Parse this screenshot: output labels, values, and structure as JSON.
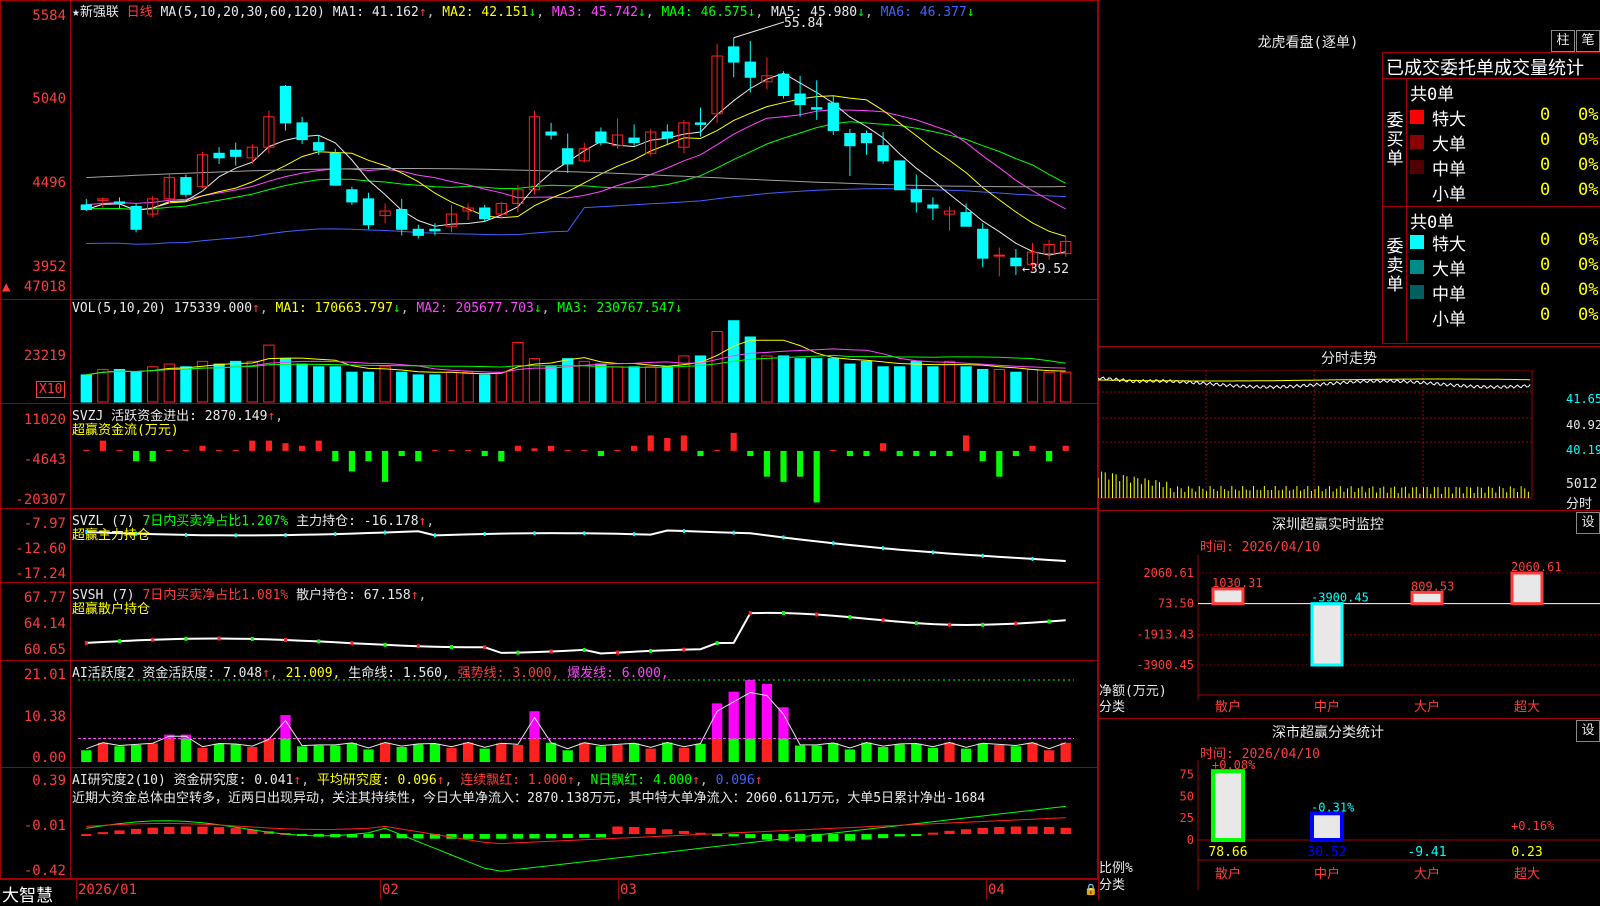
{
  "app": {
    "logo": "大智慧",
    "title_star": "★",
    "stock_name": "新强联",
    "period": "日线"
  },
  "colors": {
    "up": "#ff2020",
    "down": "#00ffff",
    "ma1": "#e8e8e8",
    "ma2": "#ffff00",
    "ma3": "#ff44ff",
    "ma4": "#00ff00",
    "ma5": "#e8e8e8",
    "ma6": "#4060ff"
  },
  "kline": {
    "header": {
      "ma_label": "MA(5,10,20,30,60,120)",
      "ma1": "MA1: 41.162",
      "ma2": "MA2: 42.151",
      "ma3": "MA3: 45.742",
      "ma4": "MA4: 46.575",
      "ma5": "MA5: 45.980",
      "ma6": "MA6: 46.377"
    },
    "y_labels": [
      "5584",
      "5040",
      "4496",
      "3952"
    ],
    "high_note": "55.84",
    "low_note": "←39.52"
  },
  "vol": {
    "header": {
      "label": "VOL(5,10,20)",
      "value": "175339.000",
      "ma1": "MA1: 170663.797",
      "ma2": "MA2: 205677.703",
      "ma3": "MA3: 230767.547"
    },
    "y_labels": [
      "47018",
      "23219"
    ],
    "unit": "X10"
  },
  "svzj": {
    "header": {
      "label": "SVZJ",
      "text": "活跃资金进出: 2870.149",
      "sub": "超赢资金流(万元)"
    },
    "y_labels": [
      "11020",
      "-4643",
      "-20307"
    ]
  },
  "svzl": {
    "header": {
      "label": "SVZL (7)",
      "text1": "7日内买卖净占比1.207%",
      "text2": "主力持仓: -16.178",
      "sub": "超赢主力持仓"
    },
    "y_labels": [
      "-7.97",
      "-12.60",
      "-17.24"
    ]
  },
  "svsh": {
    "header": {
      "label": "SVSH (7)",
      "text1": "7日内买卖净占比1.081%",
      "text2": "散户持仓: 67.158",
      "sub": "超赢散户持仓"
    },
    "y_labels": [
      "67.77",
      "64.14",
      "60.65"
    ]
  },
  "ai2": {
    "header": {
      "label": "AI活跃度2",
      "t1": "资金活跃度: 7.048",
      "t2": "21.009,",
      "t3": "生命线: 1.560,",
      "t4": "强势线: 3.000,",
      "t5": "爆发线: 6.000,"
    },
    "y_labels": [
      "21.01",
      "10.38",
      "0.00"
    ]
  },
  "ai_research": {
    "header": {
      "label": "AI研究度2(10)",
      "t1": "资金研究度: 0.041",
      "t2": "平均研究度: 0.096",
      "t3": "连续飘红: 1.000",
      "t4": "N日飘红: 4.000",
      "t5": "0.096"
    },
    "summary": "近期大资金总体由空转多，近两日出现异动，关注其持续性，今日大单净流入：2870.138万元，其中特大单净流入：2060.611万元，大单5日累计净出-1684",
    "y_labels": [
      "0.39",
      "-0.01",
      "-0.42"
    ]
  },
  "x_axis": [
    "2026/01",
    "02",
    "03",
    "04"
  ],
  "right": {
    "dragon": {
      "title": "龙虎看盘(逐单)",
      "btn1": "柱",
      "btn2": "笔",
      "subtitle": "已成交委托单成交量统计",
      "buy_label": "委买单",
      "sell_label": "委卖单",
      "buy_total": "共0单",
      "sell_total": "共0单",
      "buy_rows": [
        {
          "name": "特大",
          "v": "0",
          "p": "0%"
        },
        {
          "name": "大单",
          "v": "0",
          "p": "0%"
        },
        {
          "name": "中单",
          "v": "0",
          "p": "0%"
        },
        {
          "name": "小单",
          "v": "0",
          "p": "0%"
        }
      ],
      "sell_rows": [
        {
          "name": "特大",
          "v": "0",
          "p": "0%"
        },
        {
          "name": "大单",
          "v": "0",
          "p": "0%"
        },
        {
          "name": "中单",
          "v": "0",
          "p": "0%"
        },
        {
          "name": "小单",
          "v": "0",
          "p": "0%"
        }
      ]
    },
    "intraday": {
      "title": "分时走势",
      "p1": "41.65",
      "p2": "40.92",
      "p3": "40.19",
      "vol": "5012",
      "unit": "分时"
    },
    "monitor": {
      "title": "深圳超赢实时监控",
      "btn": "设",
      "time": "时间: 2026/04/10",
      "y_labels": [
        "2060.61",
        "73.50",
        "-1913.43",
        "-3900.45"
      ],
      "axis_name": "净额(万元)",
      "axis_cat": "分类",
      "categories": [
        "散户",
        "中户",
        "大户",
        "超大"
      ],
      "values": [
        1030.31,
        -3900.45,
        809.53,
        2060.61
      ],
      "value_labels": [
        "1030.31",
        "-3900.45",
        "809.53",
        "2060.61"
      ]
    },
    "classify": {
      "title": "深市超赢分类统计",
      "btn": "设",
      "time": "时间: 2026/04/10",
      "y_labels": [
        "75",
        "50",
        "25",
        "0"
      ],
      "axis_name": "比例%",
      "axis_cat": "分类",
      "categories": [
        "散户",
        "中户",
        "大户",
        "超大"
      ],
      "values": [
        78.66,
        30.52,
        -9.41,
        0.23
      ],
      "value_labels": [
        "78.66",
        "30.52",
        "-9.41",
        "0.23"
      ],
      "change_labels": [
        "+0.08%",
        "-0.31%",
        "",
        "+0.16%"
      ]
    }
  },
  "chart_data": [
    {
      "type": "candlestick",
      "title": "新强联 日线",
      "ylim": [
        39.52,
        55.84
      ],
      "ohlc": [
        [
          44.2,
          44.6,
          43.8,
          43.9
        ],
        [
          44.5,
          44.7,
          44.0,
          44.6
        ],
        [
          44.4,
          44.7,
          44.0,
          44.3
        ],
        [
          44.1,
          44.3,
          42.4,
          42.6
        ],
        [
          43.6,
          44.8,
          43.4,
          44.6
        ],
        [
          44.6,
          46.2,
          44.3,
          46.0
        ],
        [
          46.0,
          46.2,
          44.7,
          44.9
        ],
        [
          45.4,
          47.7,
          45.3,
          47.5
        ],
        [
          47.6,
          48.0,
          46.9,
          47.3
        ],
        [
          47.8,
          48.3,
          46.8,
          47.4
        ],
        [
          47.3,
          48.2,
          46.9,
          48.0
        ],
        [
          48.0,
          50.4,
          47.6,
          50.0
        ],
        [
          52.0,
          52.1,
          49.1,
          49.6
        ],
        [
          49.6,
          50.0,
          48.2,
          48.5
        ],
        [
          48.3,
          48.8,
          47.5,
          47.8
        ],
        [
          47.6,
          47.9,
          45.5,
          45.5
        ],
        [
          45.2,
          45.4,
          44.2,
          44.4
        ],
        [
          44.6,
          45.0,
          42.6,
          42.9
        ],
        [
          43.5,
          44.3,
          43.0,
          43.8
        ],
        [
          43.9,
          44.6,
          42.2,
          42.6
        ],
        [
          42.6,
          42.9,
          42.0,
          42.2
        ],
        [
          42.6,
          43.0,
          42.2,
          42.5
        ],
        [
          42.8,
          44.2,
          42.4,
          43.6
        ],
        [
          43.8,
          44.3,
          43.2,
          44.0
        ],
        [
          44.0,
          44.2,
          43.1,
          43.3
        ],
        [
          43.6,
          44.4,
          43.3,
          44.3
        ],
        [
          44.3,
          45.5,
          43.7,
          45.2
        ],
        [
          45.2,
          50.4,
          44.9,
          50.0
        ],
        [
          49.0,
          49.6,
          48.5,
          48.8
        ],
        [
          47.9,
          48.9,
          46.3,
          46.9
        ],
        [
          47.1,
          48.3,
          47.0,
          47.9
        ],
        [
          49.0,
          49.3,
          48.1,
          48.3
        ],
        [
          48.1,
          49.9,
          47.9,
          48.8
        ],
        [
          48.6,
          49.5,
          48.1,
          48.3
        ],
        [
          47.6,
          49.2,
          47.4,
          49.0
        ],
        [
          49.0,
          49.5,
          48.2,
          48.6
        ],
        [
          48.0,
          49.8,
          47.6,
          49.6
        ],
        [
          49.6,
          50.6,
          48.7,
          49.5
        ],
        [
          50.2,
          54.8,
          49.6,
          54.0
        ],
        [
          54.6,
          55.2,
          52.6,
          53.6
        ],
        [
          53.6,
          55.0,
          51.6,
          52.6
        ],
        [
          52.3,
          53.9,
          51.8,
          52.7
        ],
        [
          52.8,
          53.0,
          51.2,
          51.4
        ],
        [
          51.5,
          52.7,
          50.0,
          50.8
        ],
        [
          50.6,
          52.4,
          49.8,
          50.5
        ],
        [
          50.9,
          51.4,
          48.8,
          49.1
        ],
        [
          48.9,
          49.2,
          46.1,
          48.1
        ],
        [
          48.9,
          49.1,
          47.5,
          48.3
        ],
        [
          48.1,
          49.0,
          46.9,
          47.1
        ],
        [
          47.1,
          47.1,
          45.2,
          45.2
        ],
        [
          45.2,
          46.2,
          43.7,
          44.4
        ],
        [
          44.2,
          44.7,
          43.2,
          44.0
        ],
        [
          43.6,
          44.1,
          42.5,
          43.8
        ],
        [
          43.7,
          44.3,
          42.8,
          42.8
        ],
        [
          42.6,
          43.0,
          40.1,
          40.7
        ],
        [
          40.9,
          41.4,
          39.5,
          40.9
        ],
        [
          40.7,
          41.3,
          39.6,
          40.2
        ],
        [
          40.3,
          41.7,
          39.9,
          41.1
        ],
        [
          41.0,
          41.9,
          40.6,
          41.6
        ],
        [
          41.0,
          42.2,
          40.8,
          41.8
        ]
      ]
    },
    {
      "type": "bar",
      "title": "VOL",
      "values": [
        10,
        12,
        12,
        11,
        13,
        14,
        13,
        15,
        14,
        15,
        15,
        21,
        16,
        14,
        13,
        13,
        11,
        11,
        13,
        11,
        10,
        10,
        11,
        11,
        10,
        11,
        22,
        16,
        13,
        16,
        15,
        14,
        13,
        13,
        13,
        13,
        17,
        17,
        26,
        30,
        24,
        17,
        17,
        16,
        16,
        16,
        14,
        15,
        13,
        13,
        15,
        13,
        15,
        13,
        12,
        12,
        11,
        12,
        11,
        11
      ]
    },
    {
      "type": "bar",
      "title": "超赢资金流(万元)",
      "values": [
        0,
        4000,
        0,
        -4000,
        -4000,
        0,
        0,
        2000,
        0,
        0,
        4000,
        4000,
        3000,
        2000,
        4000,
        -4000,
        -8000,
        -4000,
        -12000,
        -2000,
        -4000,
        0,
        0,
        0,
        -2000,
        -4000,
        2000,
        1000,
        2000,
        0,
        0,
        -2000,
        0,
        2000,
        6000,
        5000,
        6000,
        -2000,
        0,
        7000,
        -2000,
        -10000,
        -12000,
        -10000,
        -20000,
        0,
        -2000,
        -2000,
        3000,
        -2000,
        -2000,
        -2000,
        -2000,
        6000,
        -4000,
        -10000,
        -2000,
        2000,
        -4000,
        2000
      ]
    }
  ]
}
